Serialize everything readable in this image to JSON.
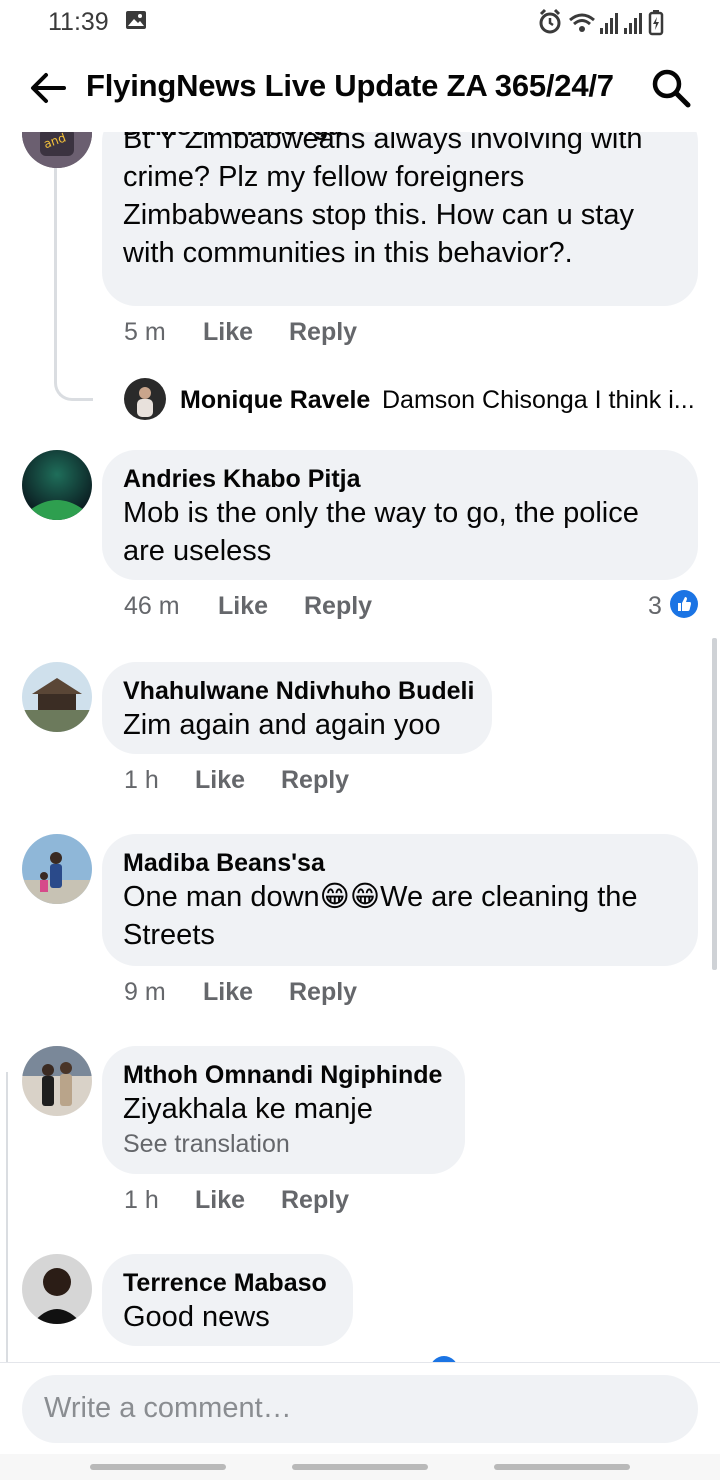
{
  "status": {
    "time": "11:39"
  },
  "header": {
    "title": "FlyingNews Live Update ZA 365/24/7"
  },
  "comments": [
    {
      "author": "Damson Chisonga",
      "text": "Bt Y Zimbabweans always involving with crime? Plz my fellow foreigners Zimbabweans stop this. How can u stay with communities in this behavior?.",
      "time": "5 m",
      "like": "Like",
      "reply": "Reply",
      "reply_preview": {
        "author": "Monique Ravele",
        "text": "Damson Chisonga I think i..."
      }
    },
    {
      "author": "Andries Khabo Pitja",
      "text": "Mob is the only the way to go, the police are useless",
      "time": "46 m",
      "like": "Like",
      "reply": "Reply",
      "reactions": "3"
    },
    {
      "author": "Vhahulwane Ndivhuho Budeli",
      "text": "Zim again and again yoo",
      "time": "1 h",
      "like": "Like",
      "reply": "Reply"
    },
    {
      "author": "Madiba Beans'sa",
      "text": "One man down😁😁We are cleaning the Streets",
      "time": "9 m",
      "like": "Like",
      "reply": "Reply"
    },
    {
      "author": "Mthoh Omnandi Ngiphinde",
      "text": "Ziyakhala ke manje",
      "translation": "See translation",
      "time": "1 h",
      "like": "Like",
      "reply": "Reply"
    },
    {
      "author": "Terrence Mabaso",
      "text": "Good news"
    }
  ],
  "avatar_text": {
    "andries": "Aim for the sun and you won't be able not even the shado"
  },
  "composer": {
    "placeholder": "Write a comment…"
  },
  "colors": {
    "accent": "#1b74e4",
    "bubble": "#f0f2f5",
    "muted": "#65676b"
  }
}
